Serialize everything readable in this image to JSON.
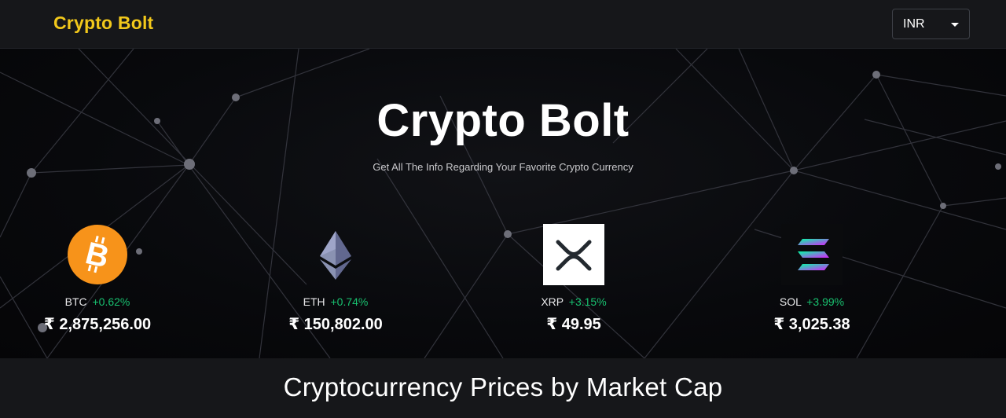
{
  "header": {
    "brand": "Crypto Bolt",
    "currency": "INR"
  },
  "hero": {
    "title": "Crypto Bolt",
    "subtitle": "Get All The Info Regarding Your Favorite Crypto Currency"
  },
  "coins": [
    {
      "symbol": "BTC",
      "change": "+0.62%",
      "price": "₹ 2,875,256.00",
      "icon": "bitcoin-icon"
    },
    {
      "symbol": "ETH",
      "change": "+0.74%",
      "price": "₹ 150,802.00",
      "icon": "ethereum-icon"
    },
    {
      "symbol": "XRP",
      "change": "+3.15%",
      "price": "₹ 49.95",
      "icon": "xrp-icon"
    },
    {
      "symbol": "SOL",
      "change": "+3.99%",
      "price": "₹ 3,025.38",
      "icon": "solana-icon"
    }
  ],
  "section": {
    "title": "Cryptocurrency Prices by Market Cap"
  },
  "colors": {
    "brand": "#f2c81b",
    "positive": "#18c06f",
    "bitcoin": "#f7931a"
  }
}
